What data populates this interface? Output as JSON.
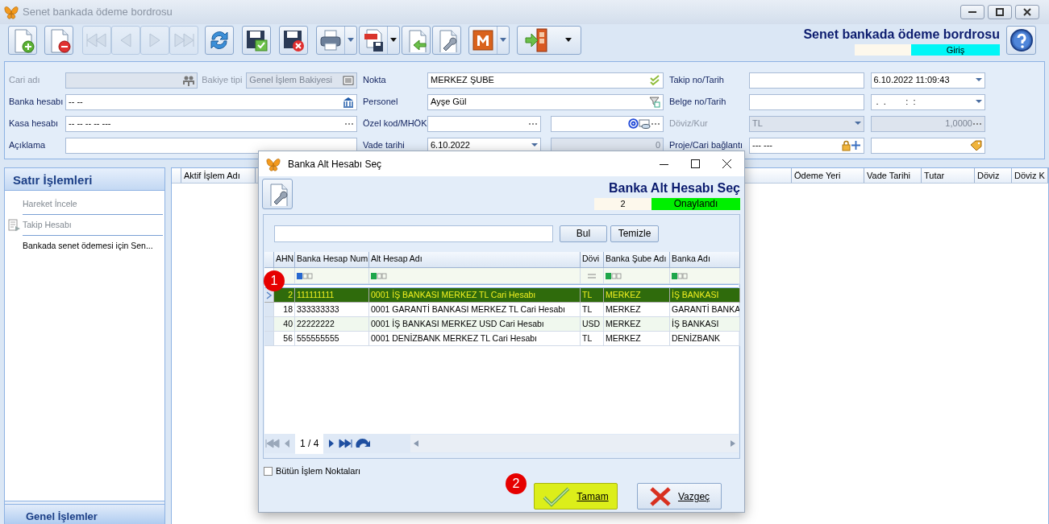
{
  "window": {
    "title": "Senet bankada ödeme bordrosu"
  },
  "toolbar": [
    {
      "kind": "new",
      "disabled": false,
      "dropdown": false
    },
    {
      "kind": "delete",
      "disabled": false,
      "dropdown": false
    },
    {
      "kind": "first",
      "disabled": true,
      "dropdown": false
    },
    {
      "kind": "prev",
      "disabled": true,
      "dropdown": false
    },
    {
      "kind": "next",
      "disabled": true,
      "dropdown": false
    },
    {
      "kind": "last",
      "disabled": true,
      "dropdown": false
    },
    {
      "kind": "refresh",
      "disabled": false,
      "dropdown": false
    },
    {
      "kind": "save-ok",
      "disabled": false,
      "dropdown": false
    },
    {
      "kind": "save-cancel",
      "disabled": false,
      "dropdown": false
    },
    {
      "kind": "print",
      "disabled": false,
      "dropdown": true
    },
    {
      "kind": "pdf",
      "disabled": false,
      "dropdown": true
    },
    {
      "kind": "import",
      "disabled": false,
      "dropdown": false
    },
    {
      "kind": "settings",
      "disabled": false,
      "dropdown": false
    },
    {
      "kind": "m",
      "disabled": false,
      "dropdown": true
    },
    {
      "kind": "exit",
      "disabled": false,
      "dropdown": true
    }
  ],
  "header": {
    "title": "Senet bankada ödeme bordrosu",
    "status": "Giriş"
  },
  "form": {
    "groups": [
      {
        "rows": [
          {
            "label": "Cari adı",
            "disabled": true,
            "items": [
              {
                "kind": "field",
                "value": "",
                "disabled": true
              },
              {
                "kind": "label",
                "text": "Bakiye tipi",
                "disabled": true
              },
              {
                "kind": "field",
                "value": "Genel İşlem Bakiyesi",
                "disabled": true
              }
            ]
          },
          {
            "label": "Banka hesabı",
            "disabled": false,
            "items": [
              {
                "kind": "field",
                "value": "-- --",
                "disabled": false
              }
            ]
          },
          {
            "label": "Kasa hesabı",
            "disabled": false,
            "items": [
              {
                "kind": "field",
                "value": "-- -- -- -- ---",
                "disabled": false
              }
            ]
          },
          {
            "label": "Açıklama",
            "disabled": false,
            "items": [
              {
                "kind": "field",
                "value": "",
                "disabled": false
              }
            ]
          }
        ]
      },
      {
        "rows": [
          {
            "label": "Nokta",
            "disabled": false,
            "items": [
              {
                "kind": "field",
                "value": "MERKEZ ŞUBE",
                "disabled": false
              }
            ]
          },
          {
            "label": "Personel",
            "disabled": false,
            "items": [
              {
                "kind": "field",
                "value": "Ayşe Gül",
                "disabled": false
              }
            ]
          },
          {
            "label": "Özel kod/MHÖK",
            "disabled": false,
            "items": [
              {
                "kind": "field",
                "value": "",
                "disabled": false
              },
              {
                "kind": "field",
                "value": "",
                "disabled": false
              }
            ]
          },
          {
            "label": "Vade tarihi",
            "disabled": false,
            "items": [
              {
                "kind": "combo",
                "value": "6.10.2022",
                "disabled": false
              },
              {
                "kind": "number",
                "value": "0",
                "disabled": true
              }
            ]
          }
        ]
      },
      {
        "rows": [
          {
            "label": "Takip no/Tarih",
            "disabled": false,
            "items": [
              {
                "kind": "field",
                "value": "",
                "disabled": false
              },
              {
                "kind": "combo",
                "value": "6.10.2022 11:09:43",
                "disabled": false
              }
            ]
          },
          {
            "label": "Belge no/Tarih",
            "disabled": false,
            "items": [
              {
                "kind": "field",
                "value": "",
                "disabled": false
              },
              {
                "kind": "combo",
                "value": " .  .        :  :",
                "disabled": false
              }
            ]
          },
          {
            "label": "Döviz/Kur",
            "disabled": true,
            "items": [
              {
                "kind": "combo",
                "value": "TL",
                "disabled": true
              },
              {
                "kind": "number",
                "value": "1,0000",
                "disabled": true
              }
            ]
          },
          {
            "label": "Proje/Cari bağlantı",
            "disabled": false,
            "items": [
              {
                "kind": "field",
                "value": "--- ---",
                "disabled": false
              },
              {
                "kind": "field",
                "value": "",
                "disabled": false
              }
            ]
          }
        ]
      }
    ]
  },
  "side_panel": {
    "title": "Satır İşlemleri",
    "items": [
      {
        "text": "Hareket İncele",
        "disabled": true,
        "icon": false
      },
      {
        "text": "Takip Hesabı",
        "disabled": true,
        "icon": true
      },
      {
        "text": "Bankada senet ödemesi için Sen...",
        "disabled": false,
        "icon": false
      }
    ],
    "footer": "Genel İşlemler"
  },
  "main_table": {
    "columns": [
      "Aktif İşlem Adı",
      "Ödeme Yeri",
      "Vade Tarihi",
      "Tutar",
      "Döviz",
      "Döviz K"
    ]
  },
  "dialog": {
    "title": "Banka Alt Hesabı Seç",
    "heading": "Banka Alt Hesabı Seç",
    "record": "2",
    "status": "Onaylandı",
    "search": {
      "buttons": [
        "Bul",
        "Temizle"
      ]
    },
    "columns": [
      {
        "title": "AHN",
        "kind": "none"
      },
      {
        "title": "Banka Hesap Num",
        "kind": "prefix"
      },
      {
        "title": "Alt Hesap Adı",
        "kind": "contains"
      },
      {
        "title": "Dövi",
        "kind": "equals"
      },
      {
        "title": "Banka Şube Adı",
        "kind": "contains"
      },
      {
        "title": "Banka Adı",
        "kind": "contains"
      }
    ],
    "rows": [
      {
        "cells": [
          "2",
          "111111111",
          "0001 İŞ BANKASI MERKEZ TL Cari Hesabı",
          "TL",
          "MERKEZ",
          "İŞ BANKASI"
        ],
        "selected": true
      },
      {
        "cells": [
          "18",
          "333333333",
          "0001 GARANTİ BANKASI MERKEZ TL Cari Hesabı",
          "TL",
          "MERKEZ",
          "GARANTİ BANKA"
        ],
        "selected": false
      },
      {
        "cells": [
          "40",
          "22222222",
          "0001 İŞ BANKASI MERKEZ USD Cari Hesabı",
          "USD",
          "MERKEZ",
          "İŞ BANKASI"
        ],
        "selected": false
      },
      {
        "cells": [
          "56",
          "555555555",
          "0001 DENİZBANK MERKEZ TL Cari Hesabı",
          "TL",
          "MERKEZ",
          "DENİZBANK"
        ],
        "selected": false
      }
    ],
    "pager": "1 / 4",
    "all_points": {
      "label": "Bütün İşlem Noktaları",
      "checked": false
    },
    "ok": {
      "label": "Tamam",
      "highlighted": true
    },
    "cancel": {
      "label": "Vazgeç",
      "highlighted": false
    },
    "markers": [
      "1",
      "2"
    ]
  }
}
